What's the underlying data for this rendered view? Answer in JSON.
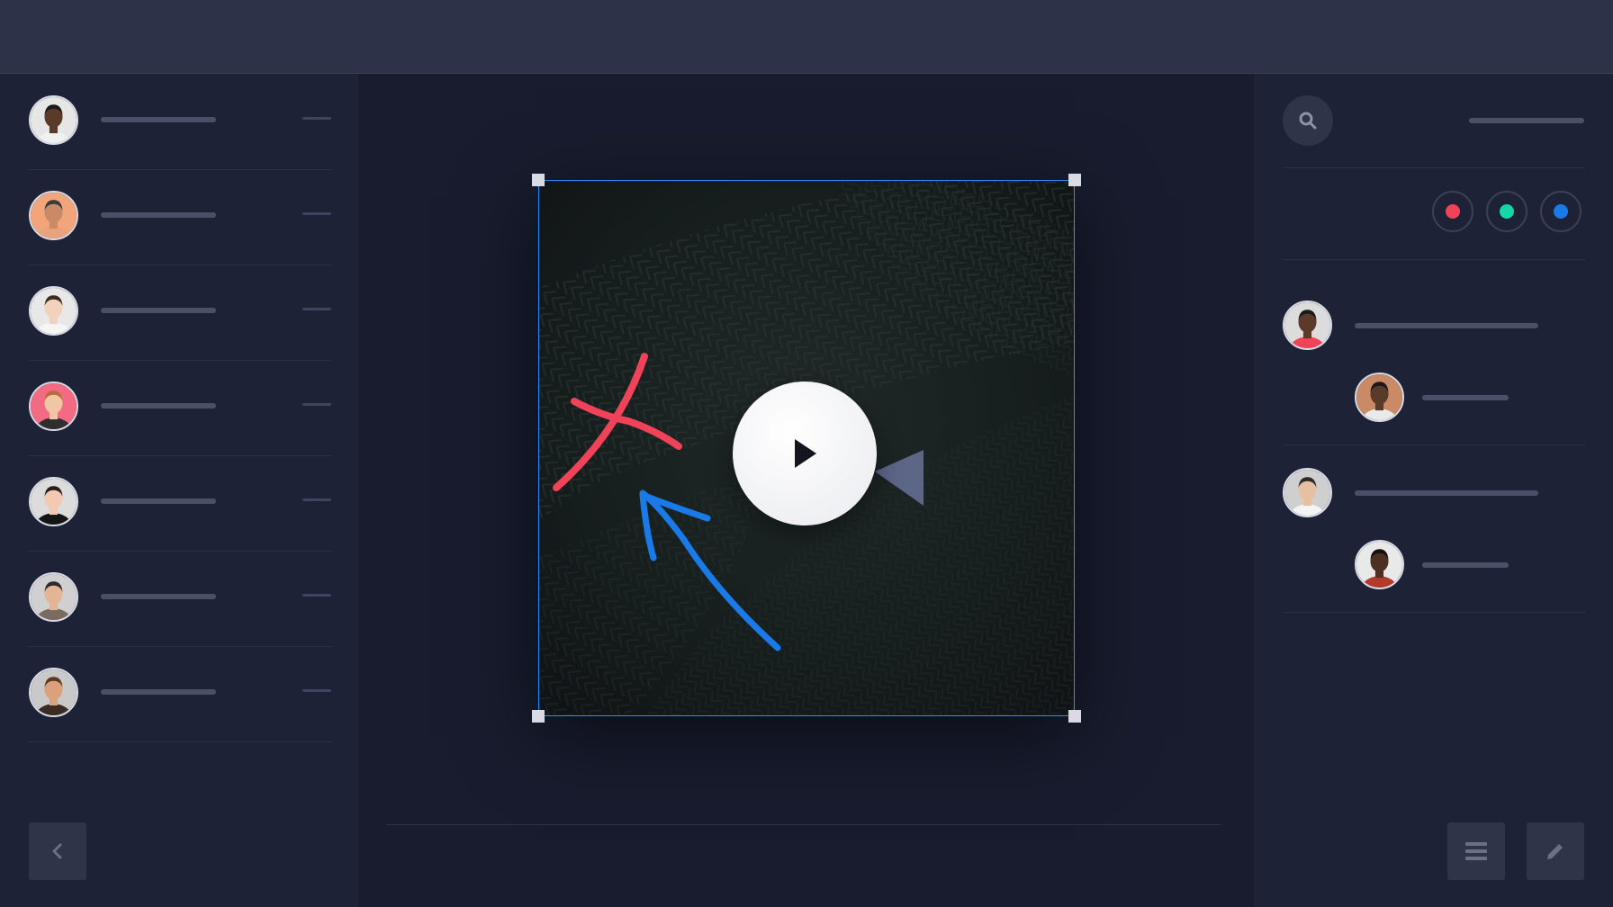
{
  "app": {
    "colors": {
      "topbar": "#2d3248",
      "panel": "#1e2236",
      "canvas_bg": "#181c2e",
      "selection": "#2a8cff",
      "annotation_red": "#f0435a",
      "annotation_blue": "#1a7ae8"
    }
  },
  "left_sidebar": {
    "users": [
      {
        "avatar": "avatar-man-smiling-icon",
        "skin": "#5a3a28",
        "shirt": "#f0f0f0",
        "hair": "#1a1a1a",
        "bg": "#e6e6e6"
      },
      {
        "avatar": "avatar-hat-icon",
        "skin": "#c98a65",
        "shirt": "#e8a27c",
        "hair": "#3a3a3a",
        "bg": "#f2a47a"
      },
      {
        "avatar": "avatar-woman-icon",
        "skin": "#f0d2bd",
        "shirt": "#f5f5f5",
        "hair": "#3d2b22",
        "bg": "#e8e8e8"
      },
      {
        "avatar": "avatar-woman-pink-bg-icon",
        "skin": "#f1c6a5",
        "shirt": "#2e2e2e",
        "hair": "#b86a3a",
        "bg": "#f36b82"
      },
      {
        "avatar": "avatar-woman-dark-hair-icon",
        "skin": "#f2c9b1",
        "shirt": "#151515",
        "hair": "#2a1d18",
        "bg": "#dcdcdc"
      },
      {
        "avatar": "avatar-man-cap-icon",
        "skin": "#e3b596",
        "shirt": "#7a6a60",
        "hair": "#2b2b2b",
        "bg": "#d0d0d0"
      },
      {
        "avatar": "avatar-man-long-hair-icon",
        "skin": "#d9a27d",
        "shirt": "#3b2b22",
        "hair": "#5a3a22",
        "bg": "#c9c9c9"
      }
    ],
    "back_button": "chevron-left-icon"
  },
  "right_sidebar": {
    "search": "search-icon",
    "colors": [
      "#f0435a",
      "#14d6a7",
      "#1a7ae8"
    ],
    "comments": [
      {
        "avatar": "avatar-woman-red-top-icon",
        "skin": "#5b3a2a",
        "shirt": "#f0435a",
        "hair": "#1a1a1a",
        "bg": "#dcdcdc",
        "reply": {
          "avatar": "avatar-man-smiling-icon",
          "skin": "#5a3a28",
          "shirt": "#eaeaea",
          "hair": "#1a1a1a",
          "bg": "#c98a65"
        }
      },
      {
        "avatar": "avatar-man-glasses-icon",
        "skin": "#e7c0a2",
        "shirt": "#f4f4f4",
        "hair": "#2b2b2b",
        "bg": "#cfcfcf",
        "reply": {
          "avatar": "avatar-man-red-shirt-icon",
          "skin": "#4e3023",
          "shirt": "#b33a2a",
          "hair": "#111111",
          "bg": "#e9e9e9"
        }
      }
    ],
    "menu_button": "menu-icon",
    "edit_button": "pencil-icon"
  },
  "canvas": {
    "image": "fern-leaves-photo",
    "play_button": "play-icon",
    "annotations": [
      "red-x-mark",
      "blue-arrow",
      "gray-triangle"
    ]
  }
}
